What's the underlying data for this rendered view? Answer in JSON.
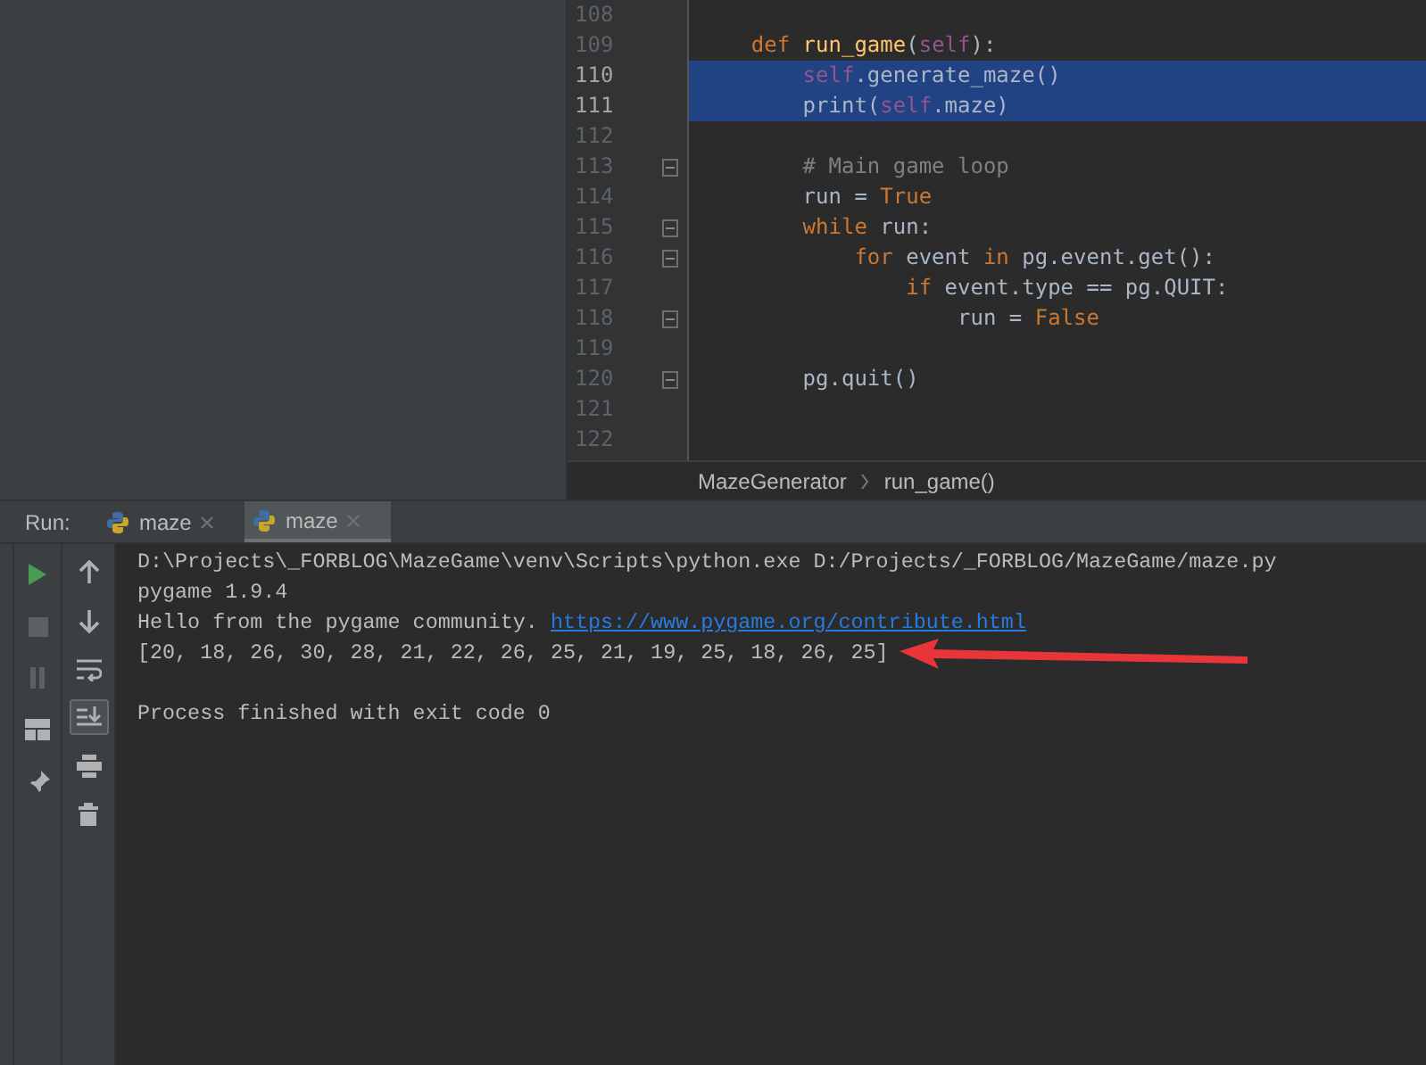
{
  "editor": {
    "lines": [
      {
        "number": "108",
        "fold": false,
        "selected": false
      },
      {
        "number": "109",
        "fold": false,
        "selected": false,
        "code": [
          {
            "kind": "keyword",
            "text": "    def"
          },
          {
            "kind": "function",
            "text": " run_game"
          },
          {
            "kind": "plain",
            "text": "("
          },
          {
            "kind": "self",
            "text": "self"
          },
          {
            "kind": "plain",
            "text": "):"
          }
        ]
      },
      {
        "number": "110",
        "fold": false,
        "selected": true,
        "code": [
          {
            "kind": "self",
            "text": "        self"
          },
          {
            "kind": "plain",
            "text": ".generate_maze()"
          }
        ]
      },
      {
        "number": "111",
        "fold": false,
        "selected": true,
        "code": [
          {
            "kind": "plain",
            "text": "        print("
          },
          {
            "kind": "self",
            "text": "self"
          },
          {
            "kind": "plain",
            "text": ".maze)"
          }
        ]
      },
      {
        "number": "112",
        "fold": false,
        "selected": false
      },
      {
        "number": "113",
        "fold": true,
        "selected": false,
        "code": [
          {
            "kind": "comment",
            "text": "        # Main game loop"
          }
        ]
      },
      {
        "number": "114",
        "fold": false,
        "selected": false,
        "code": [
          {
            "kind": "plain",
            "text": "        run = "
          },
          {
            "kind": "keyword",
            "text": "True"
          }
        ]
      },
      {
        "number": "115",
        "fold": true,
        "selected": false,
        "code": [
          {
            "kind": "keyword",
            "text": "        while"
          },
          {
            "kind": "plain",
            "text": " run:"
          }
        ]
      },
      {
        "number": "116",
        "fold": true,
        "selected": false,
        "code": [
          {
            "kind": "keyword",
            "text": "            for"
          },
          {
            "kind": "plain",
            "text": " event "
          },
          {
            "kind": "keyword",
            "text": "in"
          },
          {
            "kind": "plain",
            "text": " pg.event.get():"
          }
        ]
      },
      {
        "number": "117",
        "fold": false,
        "selected": false,
        "code": [
          {
            "kind": "keyword",
            "text": "                if"
          },
          {
            "kind": "plain",
            "text": " event.type == pg.QUIT:"
          }
        ]
      },
      {
        "number": "118",
        "fold": true,
        "selected": false,
        "code": [
          {
            "kind": "plain",
            "text": "                    run = "
          },
          {
            "kind": "keyword",
            "text": "False"
          }
        ]
      },
      {
        "number": "119",
        "fold": false,
        "selected": false
      },
      {
        "number": "120",
        "fold": true,
        "selected": false,
        "code": [
          {
            "kind": "plain",
            "text": "        pg.quit()"
          }
        ]
      },
      {
        "number": "121",
        "fold": false,
        "selected": false
      },
      {
        "number": "122",
        "fold": false,
        "selected": false
      }
    ],
    "breadcrumbs": [
      "MazeGenerator",
      "run_game()"
    ]
  },
  "run_panel": {
    "label": "Run:",
    "tabs": [
      {
        "label": "maze",
        "selected": false
      },
      {
        "label": "maze",
        "selected": true
      }
    ],
    "toolbar_left": [
      {
        "kind": "run",
        "disabled": false
      },
      {
        "kind": "stop",
        "disabled": true
      },
      {
        "kind": "pause",
        "disabled": true
      },
      {
        "kind": "layout",
        "disabled": false
      },
      {
        "kind": "pin",
        "disabled": false
      }
    ],
    "toolbar_right": [
      {
        "kind": "up",
        "on": false
      },
      {
        "kind": "down",
        "on": false
      },
      {
        "kind": "wrap",
        "on": false
      },
      {
        "kind": "scroll-end",
        "on": true
      },
      {
        "kind": "print",
        "on": false
      },
      {
        "kind": "trash",
        "on": false
      }
    ],
    "console": [
      {
        "kind": "text",
        "text": "D:\\Projects\\_FORBLOG\\MazeGame\\venv\\Scripts\\python.exe D:/Projects/_FORBLOG/MazeGame/maze.py"
      },
      {
        "kind": "text",
        "text": "pygame 1.9.4"
      },
      {
        "kind": "link_line",
        "text": "Hello from the pygame community.",
        "link": "https://www.pygame.org/contribute.html"
      },
      {
        "kind": "text",
        "text": "[20, 18, 26, 30, 28, 21, 22, 26, 25, 21, 19, 25, 18, 26, 25]",
        "annotated": true
      },
      {
        "kind": "blank"
      },
      {
        "kind": "text",
        "text": "Process finished with exit code 0"
      }
    ]
  }
}
